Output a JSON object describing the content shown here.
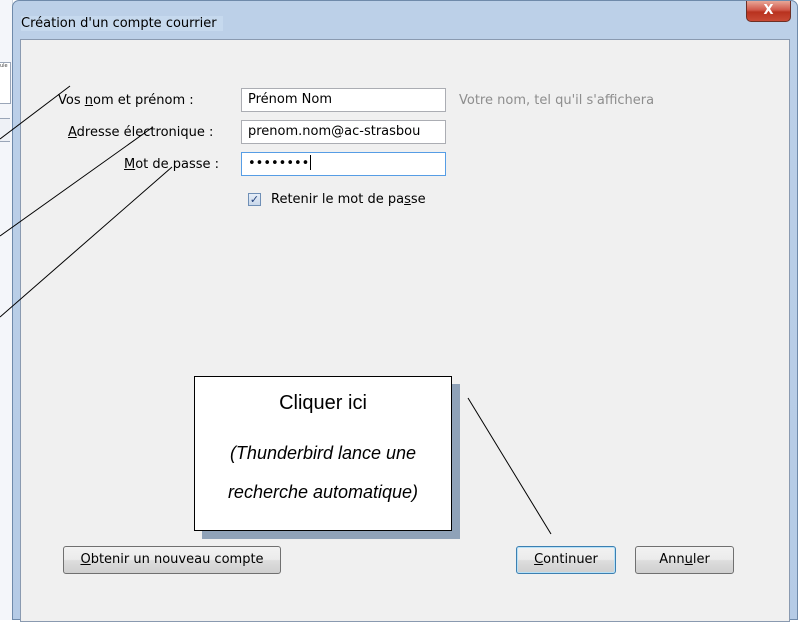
{
  "dialog": {
    "title": "Création d'un compte courrier",
    "close_symbol": "X"
  },
  "form": {
    "name_label_pre": "Vos ",
    "name_label_key": "n",
    "name_label_post": "om et prénom :",
    "name_value": "Prénom Nom",
    "name_hint": "Votre nom, tel qu'il s'affichera",
    "email_label_key": "A",
    "email_label_post": "dresse électronique :",
    "email_value": "prenom.nom@ac-strasbou",
    "password_label_key": "M",
    "password_label_post": "ot de passe :",
    "password_value": "••••••••",
    "remember_pre": "Retenir le mot de pa",
    "remember_key": "s",
    "remember_post": "se",
    "remember_checked": true
  },
  "buttons": {
    "new_account_key": "O",
    "new_account_post": "btenir un nouveau compte",
    "continue_key": "C",
    "continue_post": "ontinuer",
    "cancel_pre": "Ann",
    "cancel_key": "u",
    "cancel_post": "ler"
  },
  "callout": {
    "title": "Cliquer ici",
    "line1": "(Thunderbird lance une",
    "line2": "recherche automatique)"
  },
  "background_window": {
    "fragment_text": "ule"
  },
  "colors": {
    "frame": "#b5cbe6",
    "client": "#f0f0f0",
    "close_button": "#c94a35",
    "hint_text": "#8d8d8d",
    "callout_shadow": "#8fa2b8"
  }
}
